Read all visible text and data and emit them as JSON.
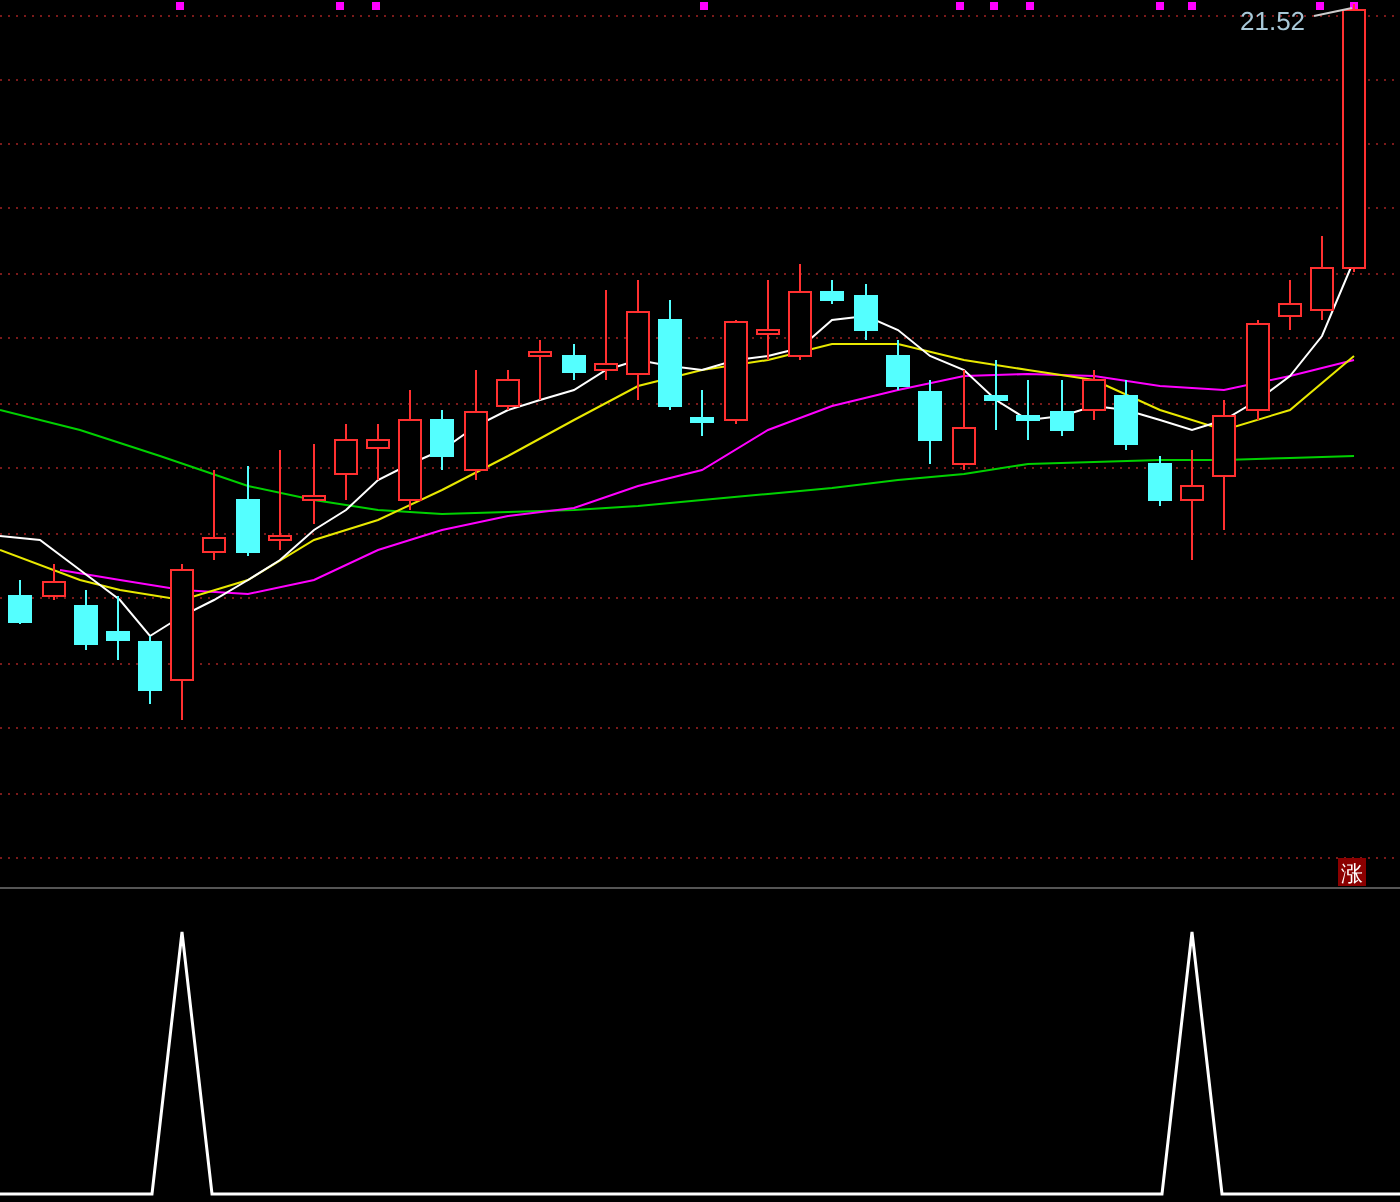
{
  "price_label": "21.52",
  "badge": "涨"
}
